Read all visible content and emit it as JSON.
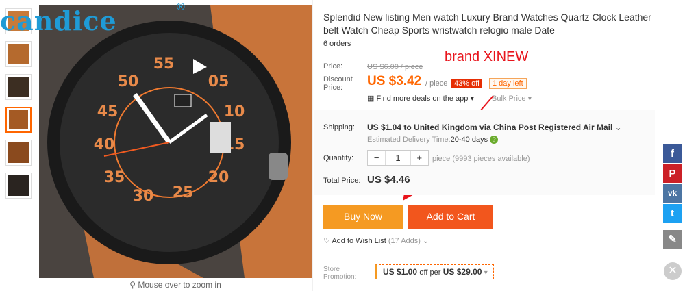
{
  "watermark": {
    "text": "candice",
    "mark": "®"
  },
  "thumbnails": [
    "thumb-1",
    "thumb-2",
    "thumb-3",
    "thumb-4",
    "thumb-5",
    "thumb-6"
  ],
  "zoom_hint": "Mouse over to zoom in",
  "product": {
    "title": "Splendid New listing Men watch Luxury Brand Watches Quartz Clock Leather belt Watch Cheap Sports wristwatch relogio male Date",
    "orders": "6 orders"
  },
  "price": {
    "label": "Price:",
    "original": "US $6.00 / piece",
    "discount_label": "Discount Price:",
    "discount_value": "US $3.42",
    "unit": "/ piece",
    "off_badge": "43% off",
    "time_badge": "1 day left",
    "deals": "Find more deals on the app",
    "bulk": "Bulk Price"
  },
  "annotation": {
    "text": "brand XINEW",
    "color": "#e8141c"
  },
  "shipping": {
    "label": "Shipping:",
    "text": "US $1.04 to United Kingdom via China Post Registered Air Mail",
    "est_label": "Estimated Delivery Time:",
    "est_value": "20-40",
    "est_unit": "days"
  },
  "quantity": {
    "label": "Quantity:",
    "minus": "−",
    "value": "1",
    "plus": "+",
    "available": "piece (9993 pieces available)"
  },
  "total": {
    "label": "Total Price:",
    "value": "US $4.46"
  },
  "buttons": {
    "buy": "Buy Now",
    "cart": "Add to Cart"
  },
  "wishlist": {
    "label": "Add to Wish List",
    "count": "(17 Adds)"
  },
  "promotion": {
    "label_line1": "Store",
    "label_line2": "Promotion:",
    "amount": "US $1.00",
    "mid": "off per",
    "threshold": "US $29.00"
  },
  "social": [
    {
      "name": "facebook",
      "glyph": "f",
      "color": "#3b5998"
    },
    {
      "name": "pinterest",
      "glyph": "P",
      "color": "#cb2027"
    },
    {
      "name": "vk",
      "glyph": "vk",
      "color": "#4c75a3"
    },
    {
      "name": "twitter",
      "glyph": "t",
      "color": "#1da1f2"
    },
    {
      "name": "edit",
      "glyph": "✎",
      "color": "#888888"
    }
  ],
  "colors": {
    "accent": "#f60",
    "buy": "#f59a22",
    "cart": "#f2561d",
    "badge": "#e62e04"
  }
}
